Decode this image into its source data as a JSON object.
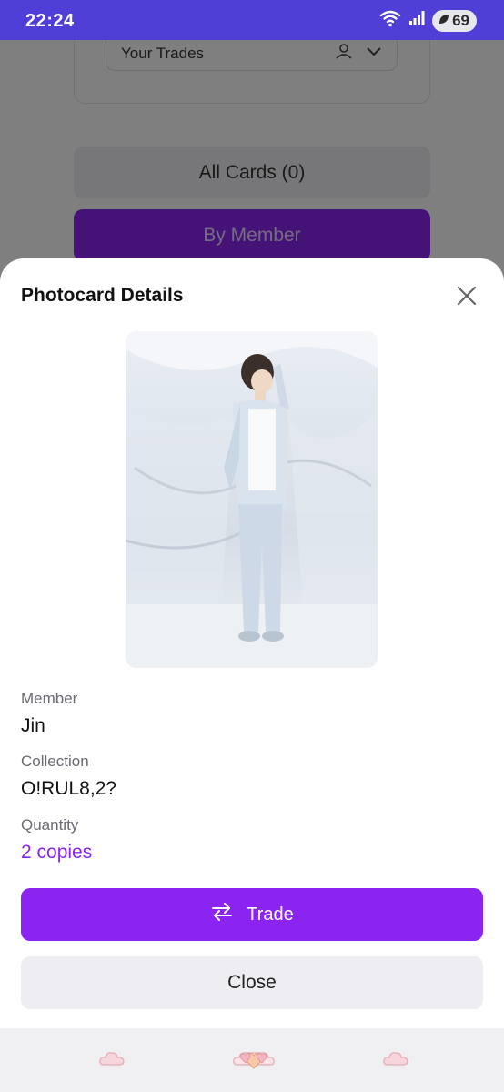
{
  "status_bar": {
    "time": "22:24",
    "battery": "69"
  },
  "background": {
    "select_label": "Your Trades",
    "all_cards_label": "All Cards (0)",
    "by_member_label": "By Member"
  },
  "modal": {
    "title": "Photocard Details",
    "photo_alt": "Photocard photo",
    "fields": {
      "member_label": "Member",
      "member_value": "Jin",
      "collection_label": "Collection",
      "collection_value": "O!RUL8,2?",
      "quantity_label": "Quantity",
      "quantity_value": "2 copies"
    },
    "trade_label": "Trade",
    "close_label": "Close"
  },
  "colors": {
    "accent": "#8b24f0",
    "status_bar": "#4f3fd6"
  },
  "bottom_nav": {
    "items": [
      "cloud-icon",
      "hearts-icon",
      "cloud-icon"
    ]
  }
}
